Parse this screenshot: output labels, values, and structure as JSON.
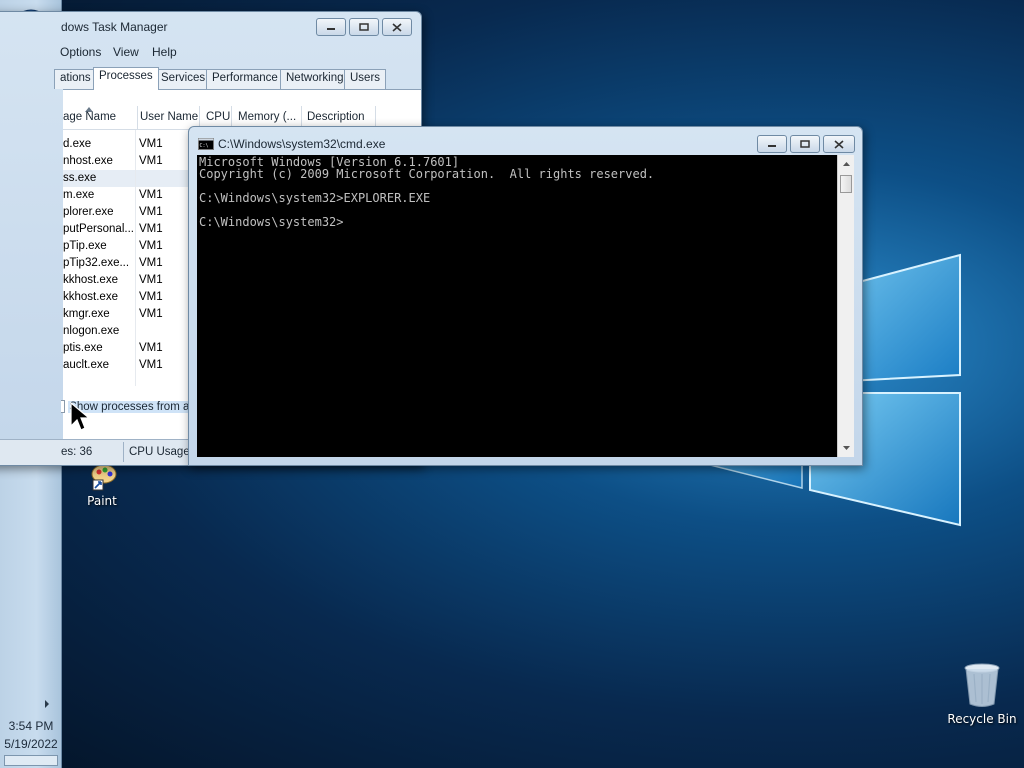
{
  "taskbar": {
    "clock_time": "3:54 PM",
    "clock_date": "5/19/2022",
    "pinned_icons": [
      "windows-start-icon",
      "file-explorer-icon",
      "chrome-icon",
      "solitaire-icon",
      "paint-icon",
      "pinball-icon",
      "steam-icon",
      "cmd-icon",
      "task-manager-icon"
    ]
  },
  "desktop": {
    "paint_label": "Paint",
    "recycle_bin_label": "Recycle Bin"
  },
  "task_manager": {
    "title": "dows Task Manager",
    "menu": [
      "Options",
      "View",
      "Help"
    ],
    "tabs": [
      "ations",
      "Processes",
      "Services",
      "Performance",
      "Networking",
      "Users"
    ],
    "selected_tab": "Processes",
    "columns": [
      "age Name",
      "User Name",
      "CPU",
      "Memory (...",
      "Description"
    ],
    "rows": [
      {
        "name": "d.exe",
        "user": "VM1"
      },
      {
        "name": "nhost.exe",
        "user": "VM1"
      },
      {
        "name": "ss.exe",
        "user": ""
      },
      {
        "name": "m.exe",
        "user": "VM1"
      },
      {
        "name": "plorer.exe",
        "user": "VM1"
      },
      {
        "name": "putPersonal...",
        "user": "VM1"
      },
      {
        "name": "pTip.exe",
        "user": "VM1"
      },
      {
        "name": "pTip32.exe...",
        "user": "VM1"
      },
      {
        "name": "kkhost.exe",
        "user": "VM1"
      },
      {
        "name": "kkhost.exe",
        "user": "VM1"
      },
      {
        "name": "kmgr.exe",
        "user": "VM1"
      },
      {
        "name": "nlogon.exe",
        "user": ""
      },
      {
        "name": "ptis.exe",
        "user": "VM1"
      },
      {
        "name": "auclt.exe",
        "user": "VM1"
      }
    ],
    "show_all_label": "Show processes from all u",
    "status_processes": "es: 36",
    "status_cpu": "CPU Usage:"
  },
  "cmd": {
    "title": "C:\\Windows\\system32\\cmd.exe",
    "console_text": "Microsoft Windows [Version 6.1.7601]\nCopyright (c) 2009 Microsoft Corporation.  All rights reserved.\n\nC:\\Windows\\system32>EXPLORER.EXE\n\nC:\\Windows\\system32>"
  }
}
